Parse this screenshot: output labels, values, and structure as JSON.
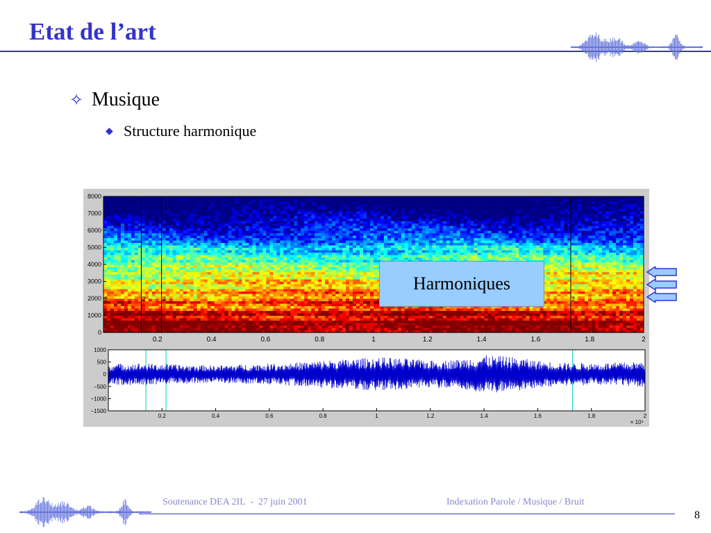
{
  "slide": {
    "title": "Etat de l’art",
    "bullet_1": "Musique",
    "bullet_2": "Structure harmonique",
    "callout": "Harmoniques",
    "footer_left": "Soutenance DEA 2IL  -  27 juin 2001",
    "footer_right": "Indexation Parole / Musique / Bruit",
    "page_number": "8"
  },
  "colors": {
    "accent": "#3333cc",
    "callout_fill": "#99ccff",
    "waveform": "#0000cc",
    "markers_waveform": "#00cccc"
  },
  "icons": {
    "bullet_1": "four-point-star-icon",
    "bullet_2": "diamond-icon",
    "arrows": "left-arrow-icon"
  },
  "chart_data": [
    {
      "type": "heatmap",
      "title": "",
      "xlabel": "",
      "ylabel": "",
      "x_ticks": [
        "0.2",
        "0.4",
        "0.6",
        "0.8",
        "1",
        "1.2",
        "1.4",
        "1.6",
        "1.8",
        "2"
      ],
      "y_ticks": [
        "0",
        "1000",
        "2000",
        "3000",
        "4000",
        "5000",
        "6000",
        "7000",
        "8000"
      ],
      "xlim": [
        0,
        2
      ],
      "ylim": [
        0,
        8000
      ],
      "grid": false,
      "harmonic_bands_hz": [
        600,
        1150,
        1800,
        2400,
        3000,
        3500,
        3950,
        4450,
        5000
      ],
      "segment_markers_x": [
        0.14,
        0.215,
        1.73
      ],
      "segment_marker_labels": [
        "2",
        "2",
        "2",
        "2"
      ]
    },
    {
      "type": "line",
      "title": "",
      "xlabel": "",
      "ylabel": "",
      "x_ticks": [
        "0.2",
        "0.4",
        "0.6",
        "0.8",
        "1",
        "1.2",
        "1.4",
        "1.6",
        "1.8",
        "2"
      ],
      "x_multiplier": "× 10⁴",
      "y_ticks": [
        "−1500",
        "−1000",
        "−500",
        "0",
        "500",
        "1000"
      ],
      "xlim": [
        0,
        2
      ],
      "ylim": [
        -1500,
        1000
      ],
      "segment_markers_x": [
        0.14,
        0.215,
        1.73
      ],
      "envelope": {
        "x": [
          0,
          0.1,
          0.2,
          0.3,
          0.4,
          0.5,
          0.6,
          0.7,
          0.8,
          0.9,
          1.0,
          1.1,
          1.2,
          1.3,
          1.4,
          1.5,
          1.6,
          1.7,
          1.8,
          1.9,
          2.0
        ],
        "amplitude": [
          420,
          450,
          420,
          380,
          360,
          400,
          430,
          480,
          560,
          620,
          700,
          650,
          560,
          600,
          780,
          720,
          560,
          470,
          450,
          480,
          520
        ]
      }
    }
  ]
}
